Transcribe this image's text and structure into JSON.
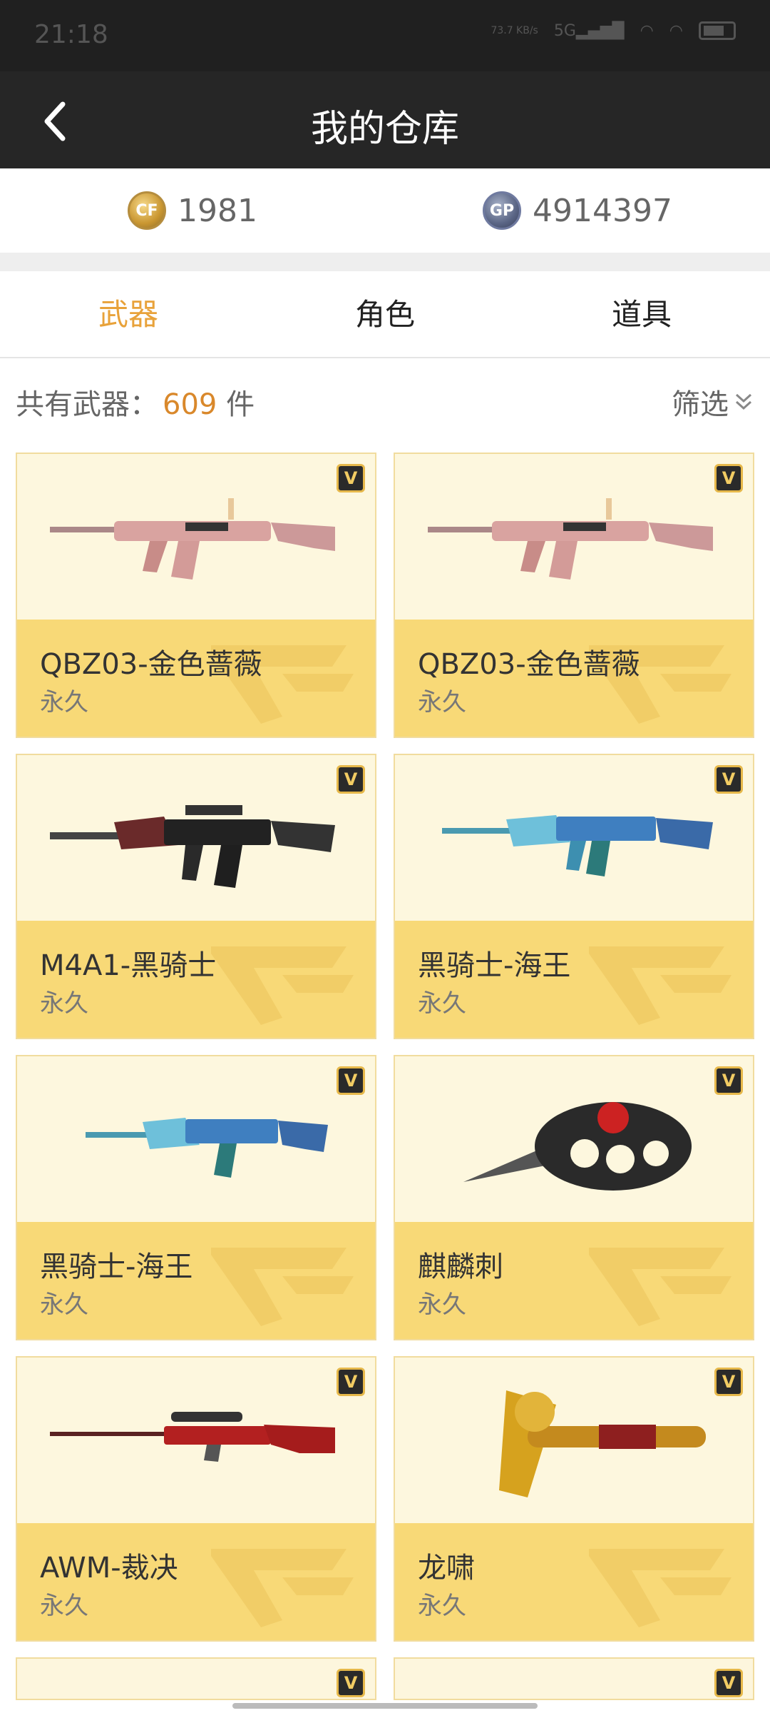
{
  "status": {
    "time": "21:18",
    "net_speed": "73.7 KB/s",
    "signal_label": "5G"
  },
  "header": {
    "title": "我的仓库"
  },
  "currency": {
    "cf_icon_text": "CF",
    "cf_value": "1981",
    "gp_icon_text": "GP",
    "gp_value": "4914397"
  },
  "tabs": [
    {
      "label": "武器"
    },
    {
      "label": "角色"
    },
    {
      "label": "道具"
    }
  ],
  "summary": {
    "prefix": "共有武器：",
    "count": "609",
    "suffix": "件",
    "filter_label": "筛选"
  },
  "items": [
    {
      "name": "QBZ03-金色蔷薇",
      "duration": "永久",
      "badge": "V",
      "weapon": "rifle-pink"
    },
    {
      "name": "QBZ03-金色蔷薇",
      "duration": "永久",
      "badge": "V",
      "weapon": "rifle-pink"
    },
    {
      "name": "M4A1-黑骑士",
      "duration": "永久",
      "badge": "V",
      "weapon": "rifle-black"
    },
    {
      "name": "黑骑士-海王",
      "duration": "永久",
      "badge": "V",
      "weapon": "rifle-blue"
    },
    {
      "name": "黑骑士-海王",
      "duration": "永久",
      "badge": "V",
      "weapon": "rifle-blue"
    },
    {
      "name": "麒麟刺",
      "duration": "永久",
      "badge": "V",
      "weapon": "knuckle-knife"
    },
    {
      "name": "AWM-裁决",
      "duration": "永久",
      "badge": "V",
      "weapon": "sniper-red"
    },
    {
      "name": "龙啸",
      "duration": "永久",
      "badge": "V",
      "weapon": "axe-gold"
    }
  ],
  "colors": {
    "accent": "#e8a23a",
    "card_info_bg": "#f8d977",
    "card_img_bg": "#fdf7de",
    "nav_bg": "#262626"
  }
}
